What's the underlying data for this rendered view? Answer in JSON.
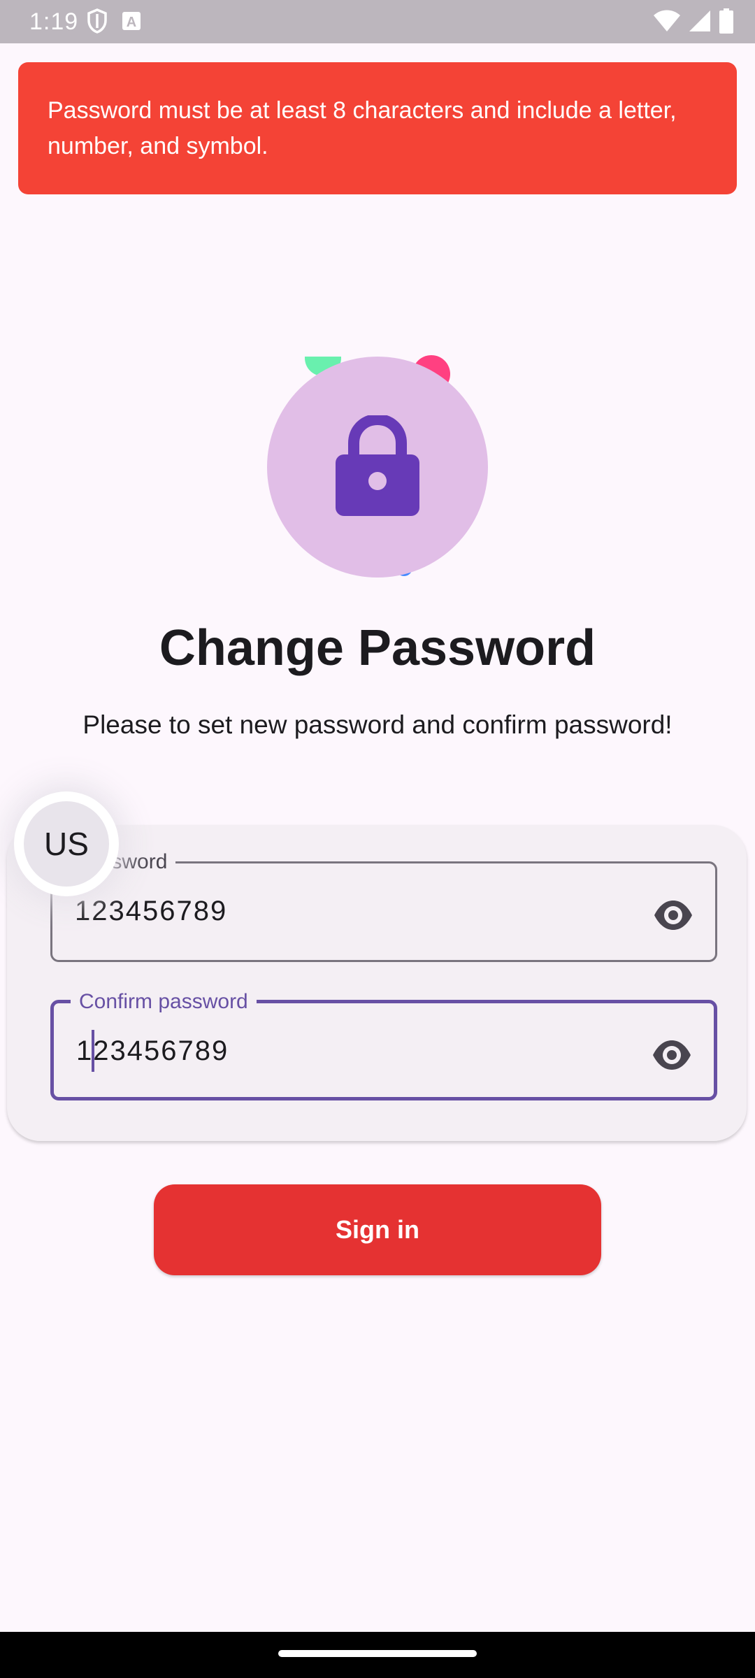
{
  "status_bar": {
    "time": "1:19",
    "left_icons": [
      "shield-icon",
      "keyboard-a-icon"
    ],
    "right_icons": [
      "wifi-icon",
      "cellular-signal-icon",
      "battery-icon"
    ]
  },
  "error_banner": {
    "message": "Password must be at least 8 characters and include a letter, number, and symbol.",
    "color": "#f44336"
  },
  "hero": {
    "icon": "lock-icon",
    "circle_color": "#e1bee7",
    "icon_color": "#673ab7"
  },
  "title": "Change Password",
  "subtitle": "Please to set new password and confirm password!",
  "form": {
    "new_password": {
      "label": "password",
      "value": "123456789",
      "toggle_icon": "eye-icon"
    },
    "confirm_password": {
      "label": "Confirm password",
      "value": "123456789",
      "toggle_icon": "eye-icon",
      "focused": true
    }
  },
  "floating_avatar": {
    "label": "US"
  },
  "sign_in_button": {
    "label": "Sign in",
    "color": "#e53232"
  }
}
